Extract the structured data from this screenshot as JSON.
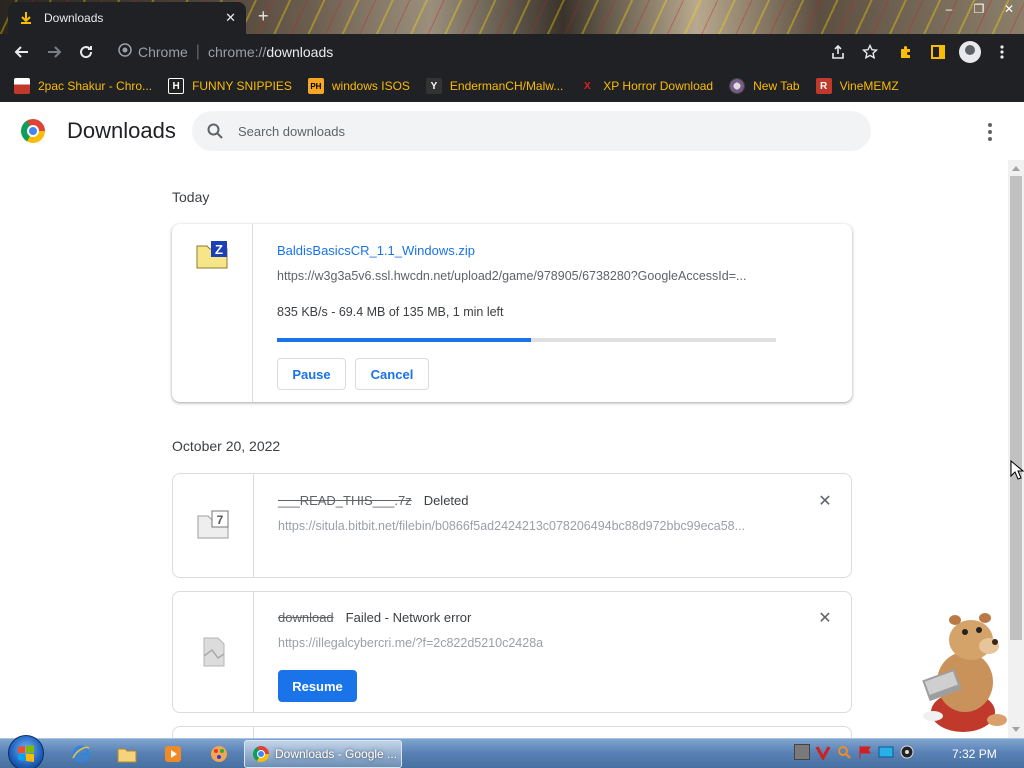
{
  "browser": {
    "tab_title": "Downloads",
    "tab_close": "✕",
    "new_tab": "+",
    "window_controls": {
      "minimize": "–",
      "maximize": "❐",
      "close": "✕"
    },
    "site_label": "Chrome",
    "url_prefix": "chrome://",
    "url_host": "downloads"
  },
  "bookmarks": [
    {
      "label": "2pac Shakur - Chro...",
      "icon": "bookmark-2pac-icon",
      "color": "#c0392b",
      "glyph": ""
    },
    {
      "label": "FUNNY SNIPPIES",
      "icon": "bookmark-h-icon",
      "color": "#ffffff",
      "glyph": "H"
    },
    {
      "label": "windows ISOS",
      "icon": "bookmark-ph-icon",
      "color": "#f5a623",
      "glyph": "PH"
    },
    {
      "label": "EndermanCH/Malw...",
      "icon": "bookmark-yp-icon",
      "color": "#333333",
      "glyph": "Y"
    },
    {
      "label": "XP Horror Download",
      "icon": "bookmark-x-icon",
      "color": "#e02020",
      "glyph": "X"
    },
    {
      "label": "New Tab",
      "icon": "bookmark-newtab-icon",
      "color": "#888888",
      "glyph": ""
    },
    {
      "label": "VineMEMZ",
      "icon": "bookmark-r-icon",
      "color": "#c0392b",
      "glyph": "R"
    }
  ],
  "header": {
    "title": "Downloads",
    "search_placeholder": "Search downloads"
  },
  "sections": {
    "today": "Today",
    "older": "October 20, 2022"
  },
  "downloads": {
    "active": {
      "filename": "BaldisBasicsCR_1.1_Windows.zip",
      "url": "https://w3g3a5v6.ssl.hwcdn.net/upload2/game/978905/6738280?GoogleAccessId=...",
      "progress_text": "835 KB/s - 69.4 MB of 135 MB, 1 min left",
      "progress_fraction": 0.51,
      "pause_label": "Pause",
      "cancel_label": "Cancel",
      "icon_letter": "Z"
    },
    "deleted": {
      "filename": "___READ_THIS___.7z",
      "status": "Deleted",
      "url": "https://situla.bitbit.net/filebin/b0866f5ad2424213c078206494bc88d972bbc99eca58...",
      "icon_letter": "7"
    },
    "failed": {
      "filename": "download",
      "status": "Failed - Network error",
      "url": "https://illegalcybercri.me/?f=2c822d5210c2428a",
      "resume_label": "Resume"
    }
  },
  "taskbar": {
    "app_label": "Downloads - Google ...",
    "clock": "7:32 PM"
  },
  "colors": {
    "accent": "#1a73e8",
    "toolbar_bg": "#202124",
    "bookmark_text": "#fbbc04"
  }
}
